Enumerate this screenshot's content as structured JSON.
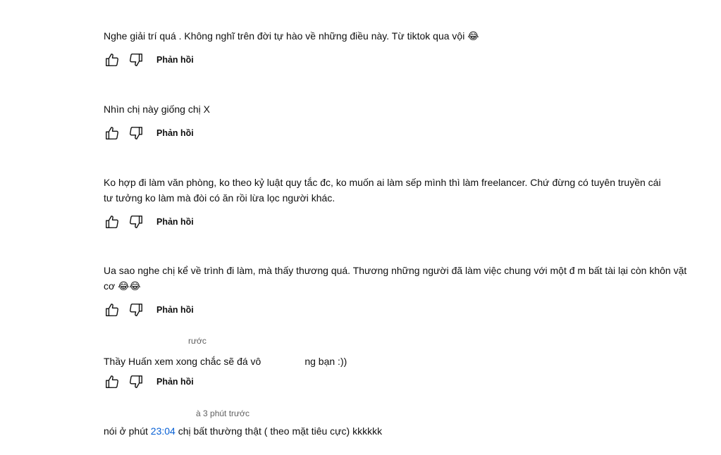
{
  "reply_label": "Phản hồi",
  "comments": [
    {
      "meta": "",
      "text": "Nghe giải trí quá . Không nghĩ trên đời tự hào về những điều này. Từ tiktok qua vội 😂"
    },
    {
      "meta": "",
      "text": "Nhìn chị này giống chị X"
    },
    {
      "meta": "",
      "text": "Ko hợp đi làm văn phòng, ko theo kỷ luật quy tắc đc, ko muốn ai làm sếp mình thì làm freelancer. Chứ đừng có tuyên truyền cái tư tưởng ko làm mà đòi có ăn rồi lừa lọc người khác."
    },
    {
      "meta": "",
      "text": "Ua sao nghe chị kể về trình đi làm, mà thấy thương quá. Thương những người đã làm việc chung với một đ         m bất tài lại còn khôn vặt cơ 😂😂"
    },
    {
      "meta": "rước",
      "text_a": "Thầy Huấn xem xong chắc sẽ đá vô",
      "text_b": "ng bạn :))"
    },
    {
      "meta": "à 3 phút trước",
      "text_a": "nói ở phút",
      "timestamp": "23:04",
      "text_b": "chị bất thường thật ( theo mặt tiêu cực) kkkkkk"
    }
  ],
  "icons": {
    "like": "thumbs-up-icon",
    "dislike": "thumbs-down-icon"
  }
}
